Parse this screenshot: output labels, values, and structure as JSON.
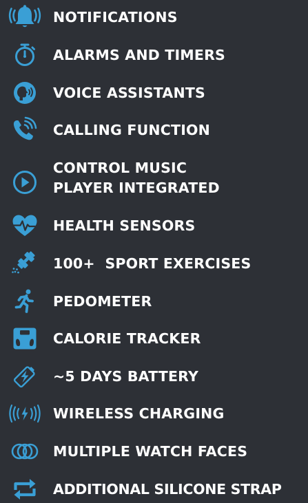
{
  "accent_color": "#3a9fd5",
  "text_color": "#ffffff",
  "background_color": "#2d3036",
  "features": [
    {
      "icon": "bell-icon",
      "label": "NOTIFICATIONS"
    },
    {
      "icon": "stopwatch-icon",
      "label": "ALARMS AND TIMERS"
    },
    {
      "icon": "voice-assistant-icon",
      "label": "VOICE ASSISTANTS"
    },
    {
      "icon": "phone-call-icon",
      "label": "CALLING FUNCTION"
    },
    {
      "icon": "play-icon",
      "label_line1": "CONTROL MUSIC",
      "label_line2": "PLAYER INTEGRATED"
    },
    {
      "icon": "heart-pulse-icon",
      "label": "HEALTH SENSORS"
    },
    {
      "icon": "dumbbell-icon",
      "label": "100+  SPORT EXERCISES"
    },
    {
      "icon": "runner-icon",
      "label": "PEDOMETER"
    },
    {
      "icon": "scale-icon",
      "label": "CALORIE TRACKER"
    },
    {
      "icon": "battery-icon",
      "label": "~5 DAYS BATTERY"
    },
    {
      "icon": "wireless-charging-icon",
      "label": "WIRELESS CHARGING"
    },
    {
      "icon": "watch-faces-icon",
      "label": "MULTIPLE WATCH FACES"
    },
    {
      "icon": "strap-swap-icon",
      "label": "ADDITIONAL SILICONE STRAP"
    }
  ]
}
